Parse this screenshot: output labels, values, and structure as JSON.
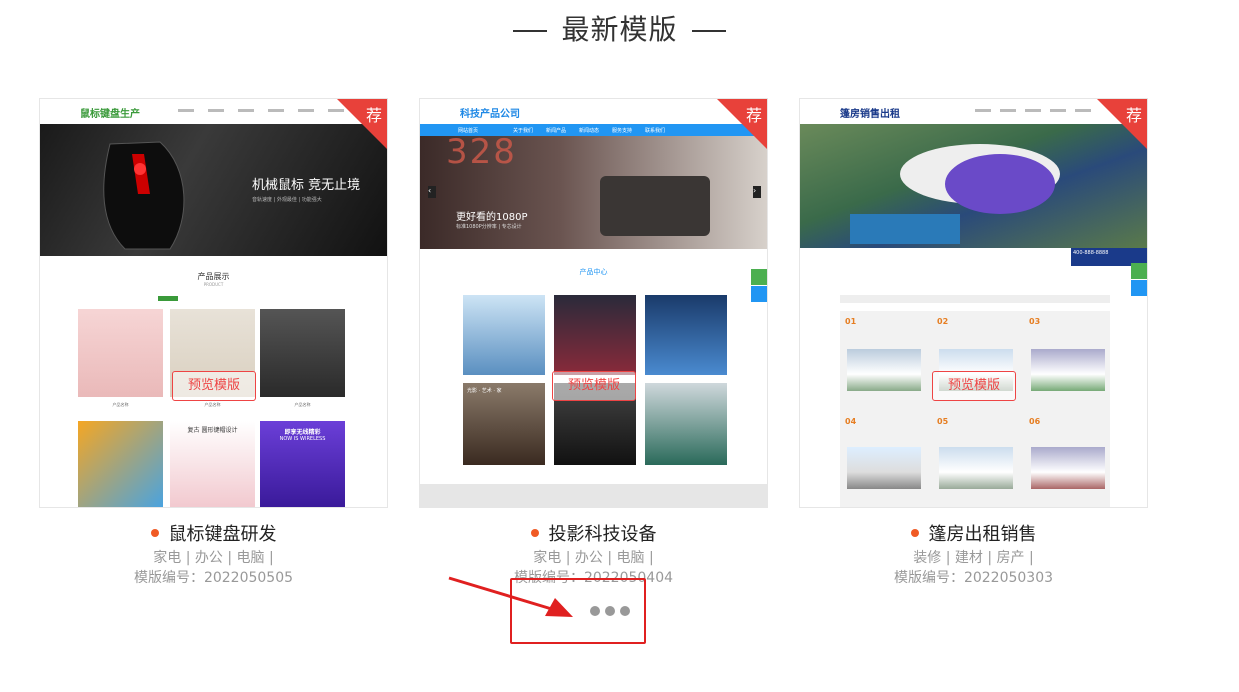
{
  "section_title": "最新模版",
  "preview_label": "预览模版",
  "badge_label": "荐",
  "cards": [
    {
      "name": "鼠标键盘研发",
      "tags": "家电 | 办公 | 电脑 |",
      "code": "模版编号：2022050505",
      "shot": {
        "logo": "鼠标键盘生产",
        "banner": "机械鼠标 竞无止境",
        "banner_sub": "音轨速度 | 外观最佳 | 功能强大",
        "section": "产品展示",
        "section_en": "PRODUCT",
        "items": [
          "产品名称",
          "产品名称",
          "产品名称"
        ],
        "promo1": "复古 圆形键帽设计",
        "promo2": "即享无线精彩",
        "promo2_en": "NOW IS WIRELESS"
      }
    },
    {
      "name": "投影科技设备",
      "tags": "家电 | 办公 | 电脑 |",
      "code": "模版编号：2022050404",
      "shot": {
        "logo": "科技产品公司",
        "nav": [
          "网站首页",
          "关于我们",
          "新闻产品",
          "新闻动态",
          "服务支持",
          "联系我们"
        ],
        "banner_num": "328",
        "banner": "更好看的1080P",
        "banner_sub": "标准1080P分辨率 | 专芯设计",
        "section": "产品中心",
        "caption": "光影 · 艺术 · 家"
      }
    },
    {
      "name": "篷房出租销售",
      "tags": "装修 | 建材 | 房产 |",
      "code": "模版编号：2022050303",
      "shot": {
        "logo": "篷房销售出租",
        "phone": "400-888-8888",
        "nums": [
          "01",
          "02",
          "03",
          "04",
          "05",
          "06"
        ]
      }
    }
  ],
  "colors": {
    "accent": "#e8413a",
    "dot": "#f05a24",
    "annotation": "#e02020"
  },
  "icons": [
    "red-arrow-annotation-icon",
    "more-dots-icon"
  ]
}
